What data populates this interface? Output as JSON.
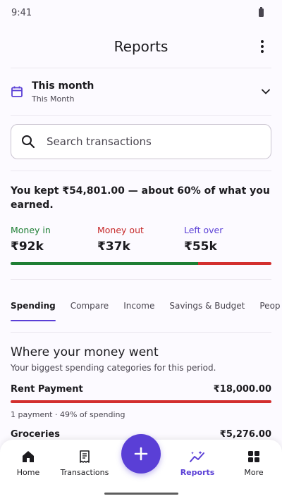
{
  "status": {
    "time": "9:41"
  },
  "app_bar": {
    "title": "Reports"
  },
  "period": {
    "label": "This month",
    "sublabel": "This Month"
  },
  "search": {
    "placeholder": "Search transactions"
  },
  "summary": {
    "text": "You kept ₹54,801.00 — about 60% of what you earned.",
    "money_in": {
      "label": "Money in",
      "value": "₹92k",
      "color": "#1e7e34"
    },
    "money_out": {
      "label": "Money out",
      "value": "₹37k",
      "color": "#c62828"
    },
    "left_over": {
      "label": "Left over",
      "value": "₹55k",
      "color": "#5a3fd6"
    },
    "kept_fraction": 0.72
  },
  "tabs": [
    "Spending",
    "Compare",
    "Income",
    "Savings & Budget",
    "Peop"
  ],
  "spending": {
    "title": "Where your money went",
    "subtitle": "Your biggest spending categories for this period.",
    "categories": [
      {
        "name": "Rent Payment",
        "amount": "₹18,000.00",
        "meta": "1 payment · 49% of spending"
      },
      {
        "name": "Groceries",
        "amount": "₹5,276.00"
      }
    ]
  },
  "nav": {
    "home": "Home",
    "transactions": "Transactions",
    "reports": "Reports",
    "more": "More"
  },
  "colors": {
    "accent": "#5a3fd6",
    "income": "#1e7e34",
    "expense": "#d32f2f"
  }
}
